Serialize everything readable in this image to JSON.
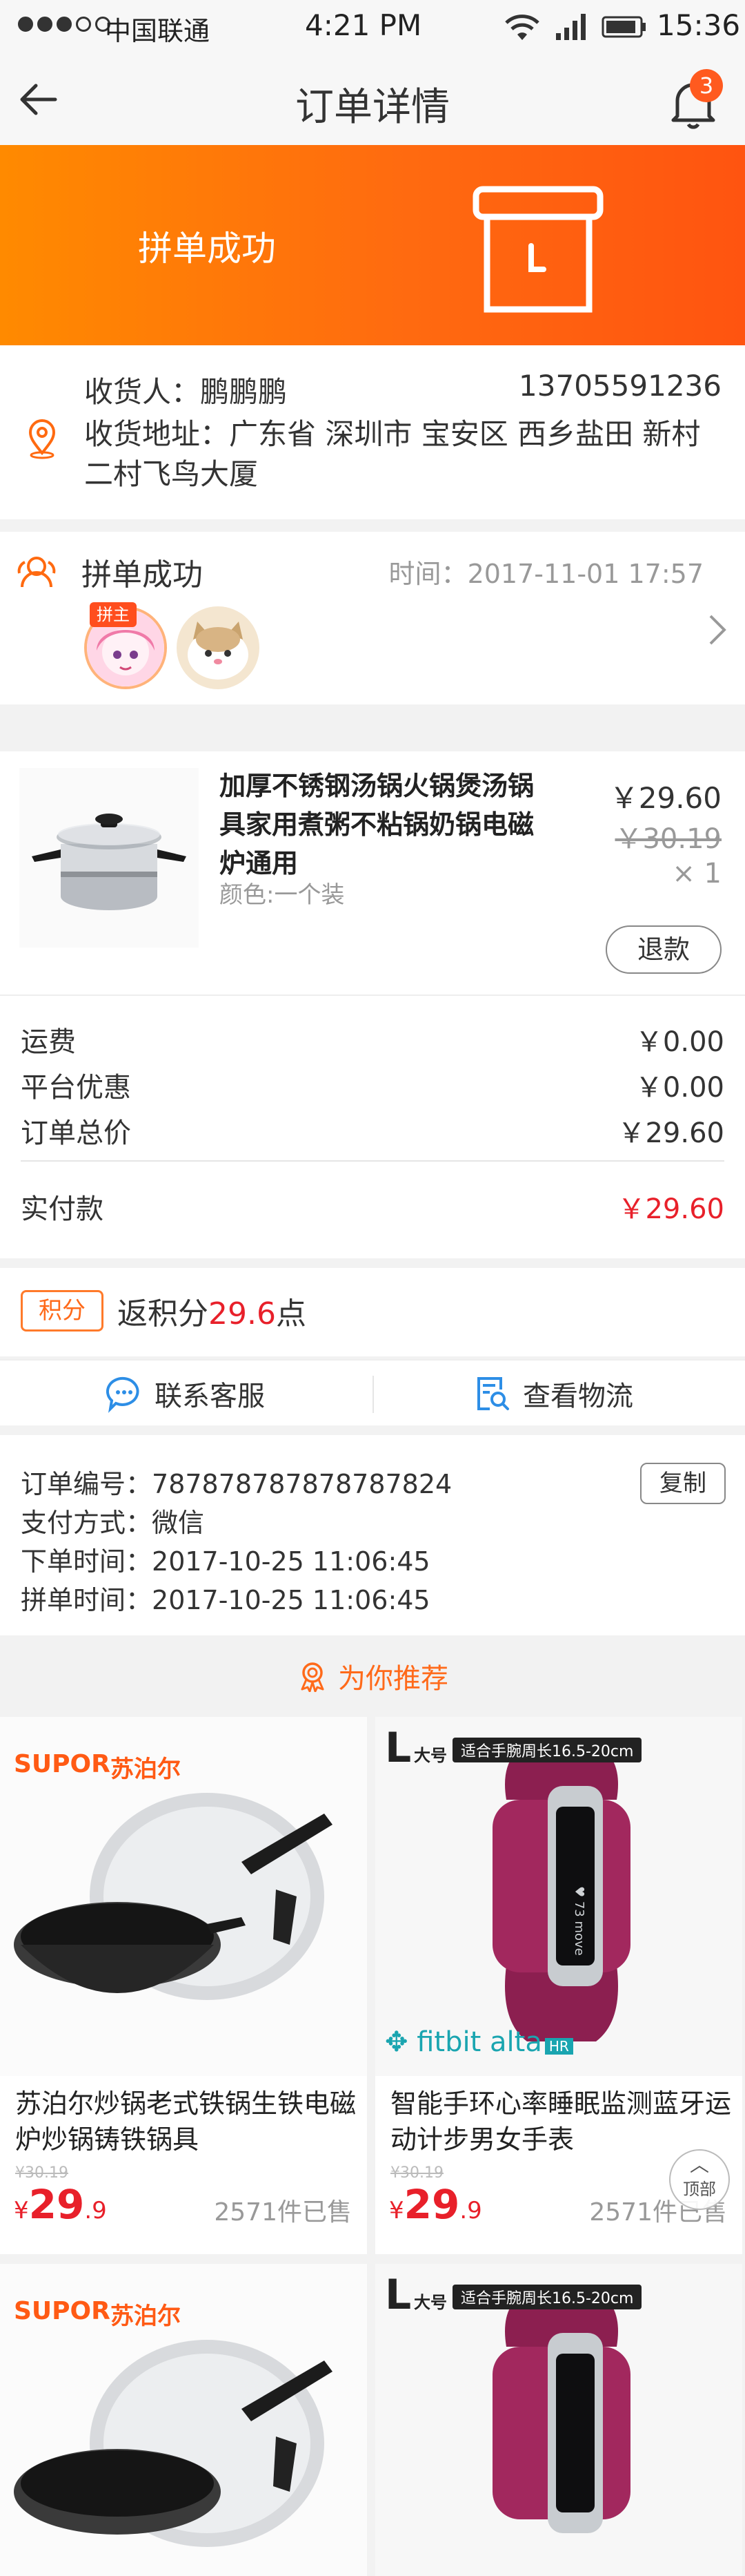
{
  "status_bar": {
    "carrier": "中国联通",
    "time_center": "4:21 PM",
    "time_right": "15:36"
  },
  "nav": {
    "title": "订单详情",
    "badge_count": "3"
  },
  "banner": {
    "status_text": "拼单成功"
  },
  "address": {
    "recipient_label": "收货人：",
    "recipient_name": "鹏鹏鹏",
    "phone": "13705591236",
    "address_label": "收货地址：",
    "address_value": "广东省 深圳市 宝安区 西乡盐田 新村二村飞鸟大厦"
  },
  "group": {
    "status": "拼单成功",
    "time_label": "时间：",
    "time_value": "2017-11-01 17:57",
    "owner_tag": "拼主"
  },
  "product": {
    "title": "加厚不锈钢汤锅火锅煲汤锅具家用煮粥不粘锅奶锅电磁炉通用",
    "spec": "颜色:一个装",
    "price": "￥29.60",
    "original_price": "￥30.19",
    "quantity": "× 1",
    "refund_label": "退款"
  },
  "fees": {
    "shipping_label": "运费",
    "shipping_value": "￥0.00",
    "discount_label": "平台优惠",
    "discount_value": "￥0.00",
    "total_label": "订单总价",
    "total_value": "￥29.60",
    "paid_label": "实付款",
    "paid_value": "￥29.60"
  },
  "points": {
    "tag": "积分",
    "prefix": "返积分",
    "amount": "29.6",
    "suffix": "点"
  },
  "actions": {
    "service_label": "联系客服",
    "logistics_label": "查看物流"
  },
  "order_info": {
    "number_label": "订单编号：",
    "number_value": "787878787878787824",
    "copy_label": "复制",
    "payment_label": "支付方式：",
    "payment_value": "微信",
    "order_time_label": "下单时间：",
    "order_time_value": "2017-10-25  11:06:45",
    "group_time_label": "拼单时间：",
    "group_time_value": "2017-10-25  11:06:45"
  },
  "recommend": {
    "heading": "为你推荐",
    "back_top_label": "顶部",
    "items": [
      {
        "brand": "SUPOR",
        "brand_cn": "苏泊尔",
        "title": "苏泊尔炒锅老式铁锅生铁电磁炉炒锅铸铁锅具",
        "original_price": "¥30.19",
        "currency": "¥",
        "price_int": "29",
        "price_dec": ".9",
        "sold": "2571件已售"
      },
      {
        "size_letter": "L",
        "size_cn": "大号",
        "size_tag": "适合手腕周长16.5-20cm",
        "brand": "fitbit alta",
        "brand_badge": "HR",
        "title": "智能手环心率睡眠监测蓝牙运动计步男女手表",
        "original_price": "¥30.19",
        "currency": "¥",
        "price_int": "29",
        "price_dec": ".9",
        "sold": "2571件已售"
      },
      {
        "brand": "SUPOR",
        "brand_cn": "苏泊尔"
      },
      {
        "size_letter": "L",
        "size_cn": "大号",
        "size_tag": "适合手腕周长16.5-20cm"
      }
    ]
  },
  "colors": {
    "accent": "#ff6a10",
    "price_red": "#e8202a",
    "banner_start": "#ff8a00",
    "banner_end": "#ff5410",
    "fitbit": "#1aa5b0",
    "band": "#9b2257"
  }
}
